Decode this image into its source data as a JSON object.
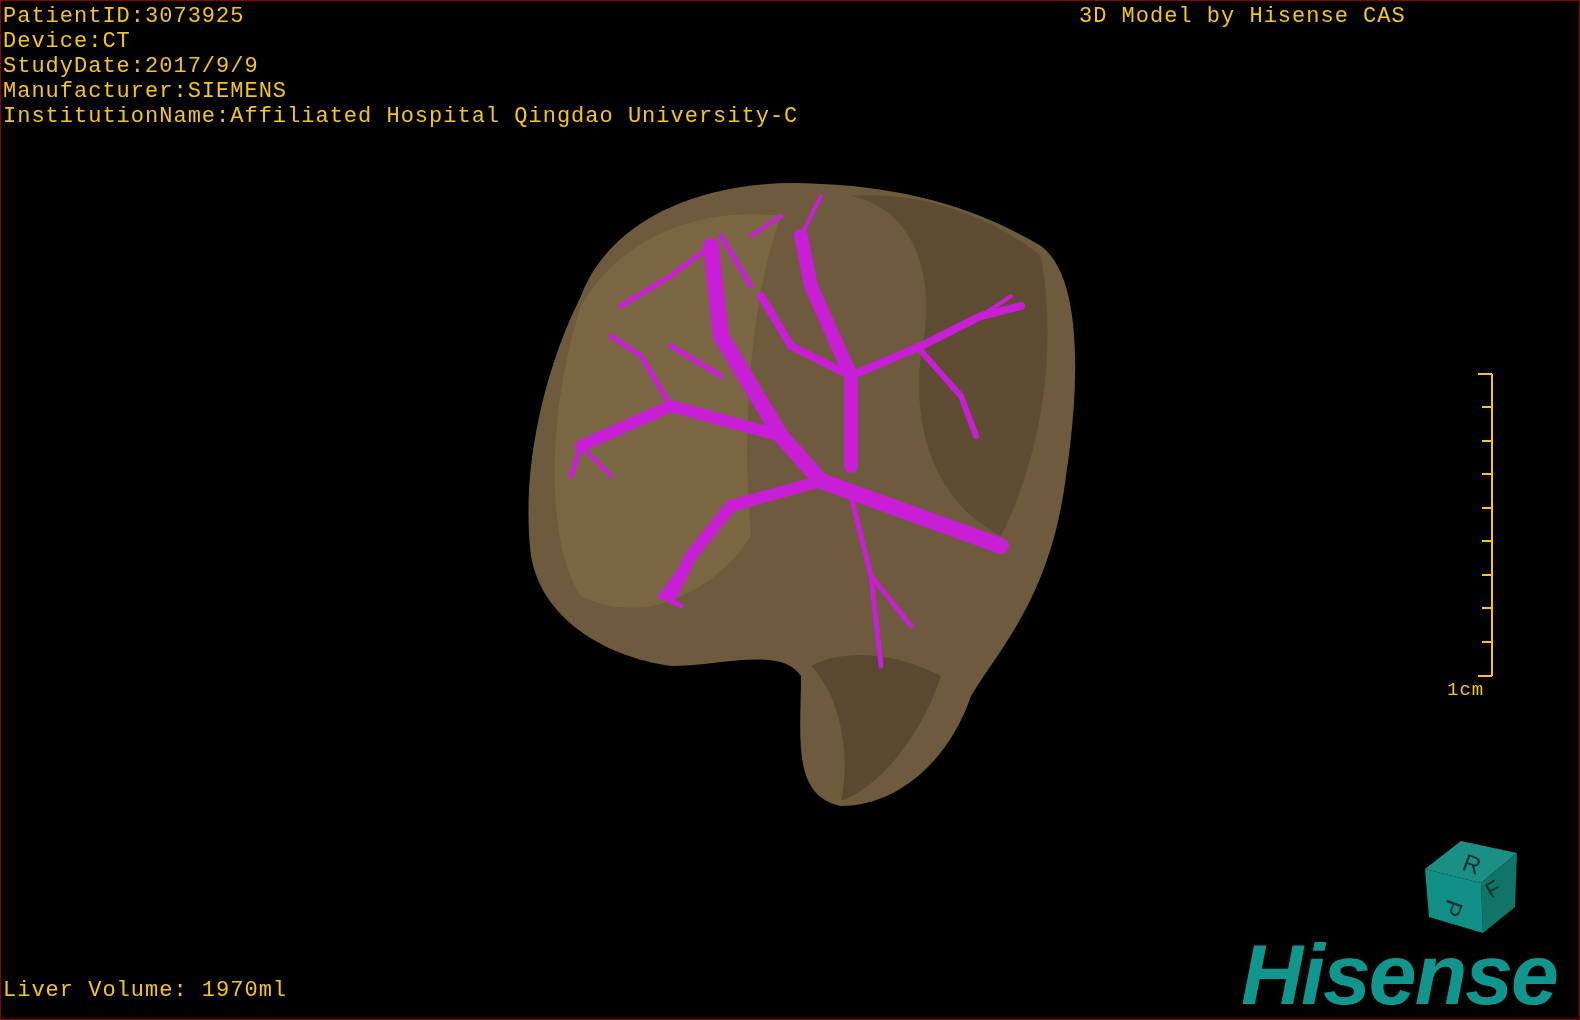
{
  "info_lines": [
    "PatientID:3073925",
    "Device:CT",
    "StudyDate:2017/9/9",
    "Manufacturer:SIEMENS",
    "InstitutionName:Affiliated Hospital Qingdao University-C"
  ],
  "title": "3D Model by Hisense CAS",
  "scale_bar": {
    "label": "1cm"
  },
  "orientation_cube": {
    "faces": [
      "R",
      "F",
      "P"
    ]
  },
  "volume": "Liver Volume: 1970ml",
  "logo": "Hisense"
}
